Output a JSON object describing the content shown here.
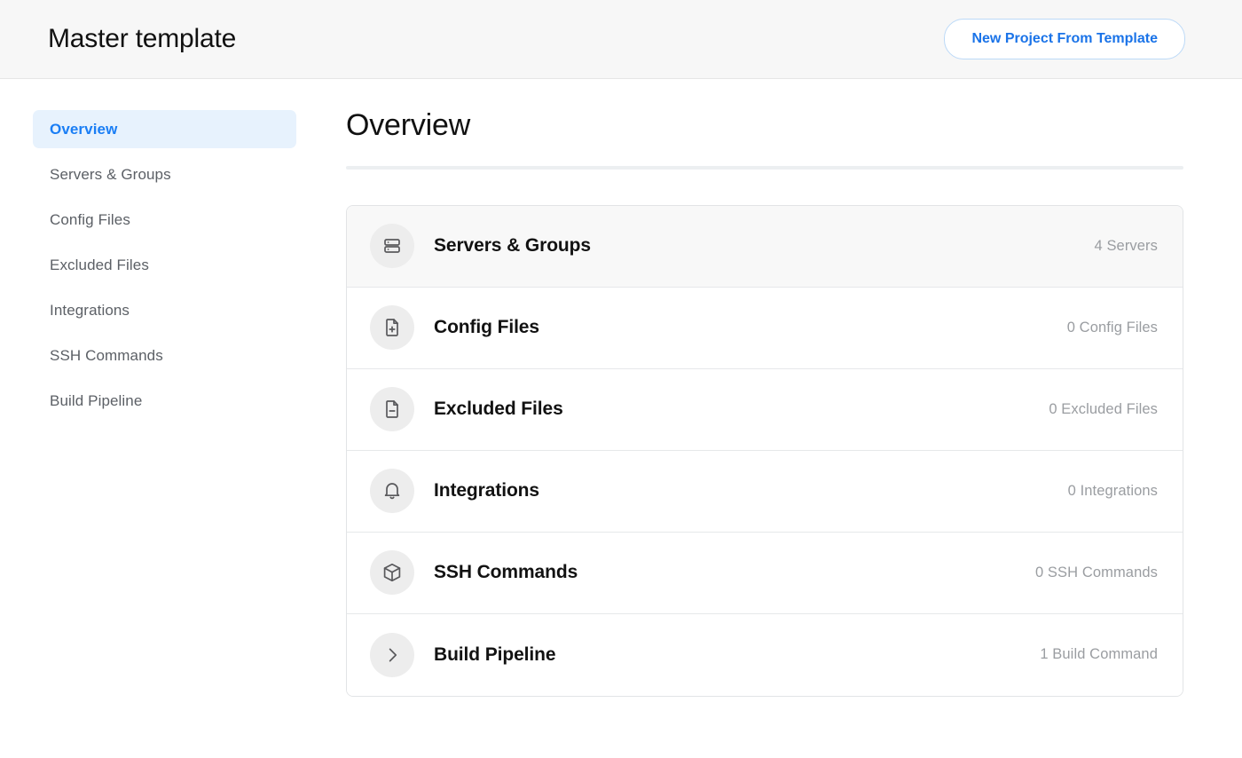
{
  "header": {
    "title": "Master template",
    "action_label": "New Project From Template"
  },
  "sidebar": {
    "items": [
      {
        "label": "Overview",
        "active": true
      },
      {
        "label": "Servers & Groups",
        "active": false
      },
      {
        "label": "Config Files",
        "active": false
      },
      {
        "label": "Excluded Files",
        "active": false
      },
      {
        "label": "Integrations",
        "active": false
      },
      {
        "label": "SSH Commands",
        "active": false
      },
      {
        "label": "Build Pipeline",
        "active": false
      }
    ]
  },
  "main": {
    "title": "Overview",
    "rows": [
      {
        "label": "Servers & Groups",
        "count": "4 Servers",
        "icon": "server-icon",
        "highlight": true
      },
      {
        "label": "Config Files",
        "count": "0 Config Files",
        "icon": "file-plus-icon",
        "highlight": false
      },
      {
        "label": "Excluded Files",
        "count": "0 Excluded Files",
        "icon": "file-minus-icon",
        "highlight": false
      },
      {
        "label": "Integrations",
        "count": "0 Integrations",
        "icon": "bell-icon",
        "highlight": false
      },
      {
        "label": "SSH Commands",
        "count": "0 SSH Commands",
        "icon": "box-icon",
        "highlight": false
      },
      {
        "label": "Build Pipeline",
        "count": "1 Build Command",
        "icon": "chevron-right-icon",
        "highlight": false
      }
    ]
  },
  "colors": {
    "accent_blue": "#1a7ef5",
    "link_blue": "#1a73e8",
    "active_bg": "#e7f2fd",
    "header_bg": "#f7f7f7",
    "icon_bg": "#ededed",
    "muted_text": "#9a9da1",
    "sidebar_text": "#5c6066"
  }
}
